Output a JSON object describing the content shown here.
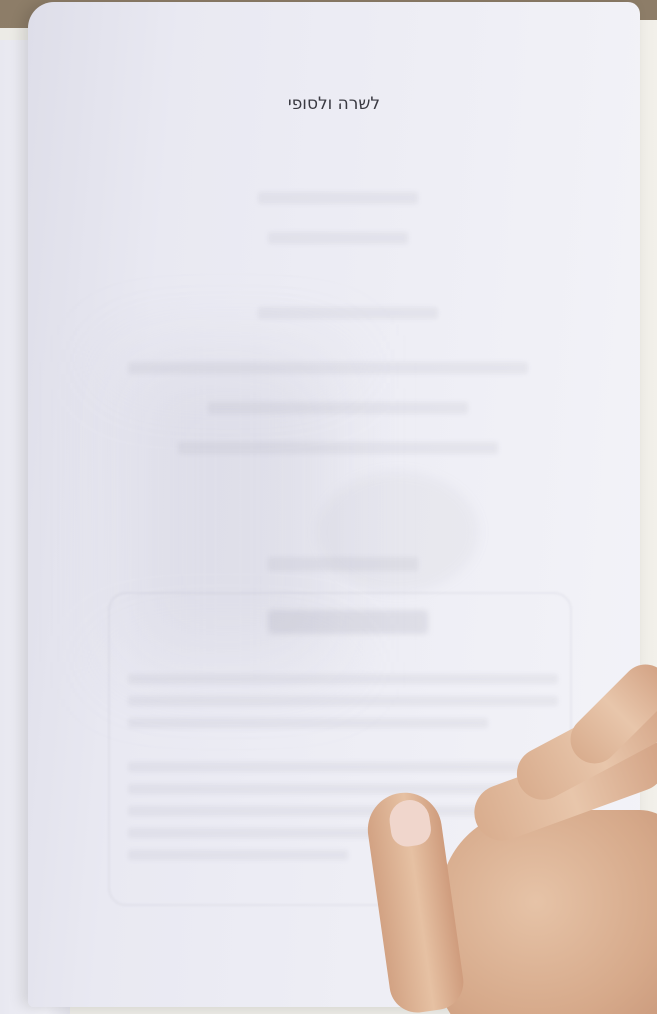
{
  "book": {
    "running_header": "לשרה ולסופי"
  }
}
